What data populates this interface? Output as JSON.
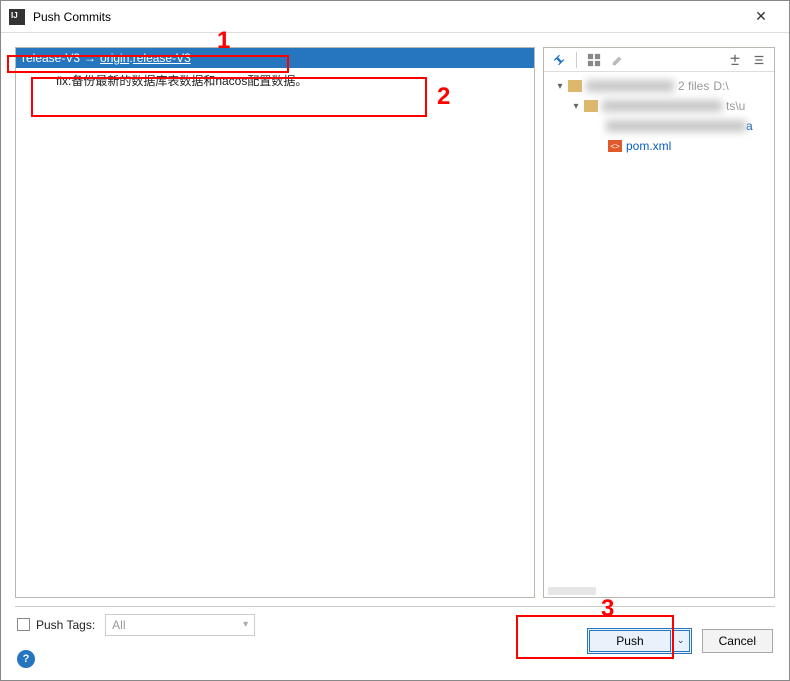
{
  "title": "Push Commits",
  "branch": {
    "local": "release-V3",
    "remote_link": "origin",
    "sep": " : ",
    "remote_branch": "release-V3"
  },
  "commit_message": "fix:备份最新的数据库表数据和nacos配置数据。",
  "tree": {
    "root_meta_files": "2 files",
    "root_meta_path": "D:\\",
    "sub_meta": "ts\\u",
    "file_a_suffix": "a",
    "files": [
      {
        "name": "pom.xml"
      }
    ]
  },
  "push_tags": {
    "label": "Push Tags:",
    "value": "All"
  },
  "buttons": {
    "push": "Push",
    "cancel": "Cancel"
  },
  "annotations": {
    "n1": "1",
    "n2": "2",
    "n3": "3"
  }
}
